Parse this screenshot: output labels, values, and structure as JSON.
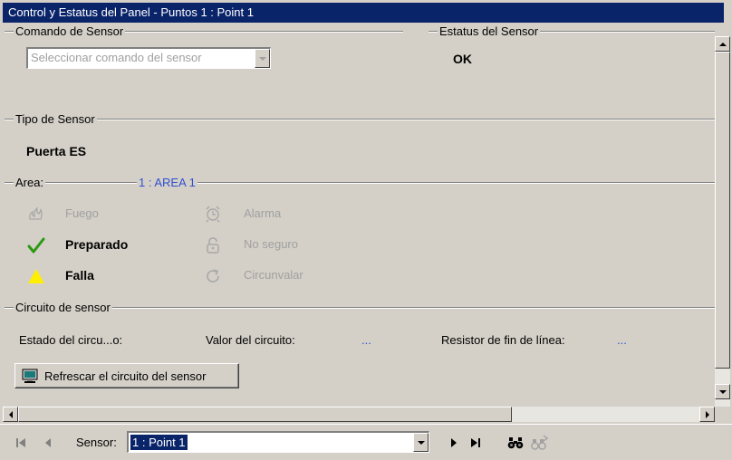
{
  "window": {
    "title": "Control y Estatus del Panel - Puntos 1 : Point 1"
  },
  "sensor_command": {
    "legend": "Comando de Sensor",
    "select_value": "Seleccionar comando del sensor"
  },
  "sensor_status": {
    "legend": "Estatus del Sensor",
    "value": "OK"
  },
  "sensor_type": {
    "legend": "Tipo de Sensor",
    "value": "Puerta ES"
  },
  "area": {
    "legend": "Area:",
    "value": "1 : AREA 1",
    "items": [
      {
        "label": "Fuego",
        "icon": "fire-icon",
        "active": false
      },
      {
        "label": "Alarma",
        "icon": "alarm-clock-icon",
        "active": false
      },
      {
        "label": "Preparado",
        "icon": "checkmark-icon",
        "active": true,
        "color": "#2a9a10"
      },
      {
        "label": "No seguro",
        "icon": "unlock-icon",
        "active": false
      },
      {
        "label": "Falla",
        "icon": "warning-triangle-icon",
        "active": true,
        "color": "#ffee00"
      },
      {
        "label": "Circunvalar",
        "icon": "bypass-icon",
        "active": false
      }
    ]
  },
  "circuit": {
    "legend": "Circuito de sensor",
    "state_label": "Estado del circu...o:",
    "value_label": "Valor del circuito:",
    "value": "...",
    "resistor_label": "Resistor de fin de línea:",
    "resistor_value": "...",
    "refresh_button": "Refrescar el circuito del sensor"
  },
  "navigation": {
    "sensor_label": "Sensor:",
    "sensor_value": "1 : Point 1"
  },
  "colors": {
    "title_bar": "#0a246a",
    "selection": "#0a246a",
    "area_value": "#3050d0"
  }
}
